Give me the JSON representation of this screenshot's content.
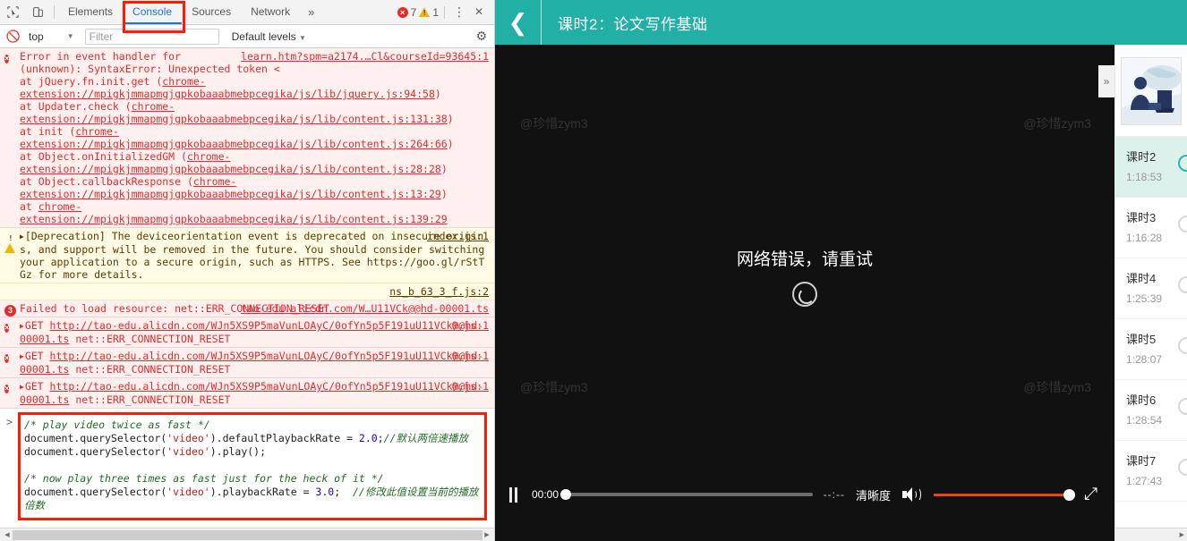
{
  "devtools": {
    "toolbar": {
      "inspect_icon": "cursor-inspect-icon",
      "device_icon": "device-toolbar-icon",
      "tabs": [
        {
          "label": "Elements",
          "active": false
        },
        {
          "label": "Console",
          "active": true
        },
        {
          "label": "Sources",
          "active": false
        },
        {
          "label": "Network",
          "active": false
        }
      ],
      "more_tabs": "»",
      "error_count": "7",
      "warning_count": "1",
      "kebab_icon": "more-options-icon",
      "close_icon": "close-icon"
    },
    "filterbar": {
      "clear_icon": "clear-console-icon",
      "context": "top",
      "filter_placeholder": "Filter",
      "filter_value": "",
      "levels": "Default levels",
      "settings_icon": "gear-icon"
    },
    "messages": [
      {
        "type": "error",
        "source": "learn.htm?spm=a2174.…Cl&courseId=93645:1",
        "line1": "Error in event handler for",
        "line2": "(unknown): SyntaxError: Unexpected token <",
        "stack": [
          {
            "fn": "at jQuery.fn.init.get",
            "url": "chrome-extension://mpigkjmmapmgjgpkobaaabmebpcegika/js/lib/jquery.js:94:58"
          },
          {
            "fn": "at Updater.check",
            "url": "chrome-extension://mpigkjmmapmgjgpkobaaabmebpcegika/js/lib/content.js:131:38"
          },
          {
            "fn": "at init",
            "url": "chrome-extension://mpigkjmmapmgjgpkobaaabmebpcegika/js/lib/content.js:264:66"
          },
          {
            "fn": "at Object.onInitializedGM",
            "url": "chrome-extension://mpigkjmmapmgjgpkobaaabmebpcegika/js/lib/content.js:28:28"
          },
          {
            "fn": "at Object.callbackResponse",
            "url": "chrome-extension://mpigkjmmapmgjgpkobaaabmebpcegika/js/lib/content.js:13:29"
          },
          {
            "fn": "at",
            "url": "chrome-extension://mpigkjmmapmgjgpkobaaabmebpcegika/js/lib/content.js:139:29"
          }
        ]
      },
      {
        "type": "warn",
        "source": "index.js:1",
        "text": "[Deprecation] The deviceorientation event is deprecated on insecure origins, and support will be removed in the future. You should consider switching your application to a secure origin, such as HTTPS. See https://goo.gl/rStTGz for more details.",
        "link": "https://goo.gl/rStTGz"
      },
      {
        "type": "source-only",
        "source": "ns_b_63_3_f.js:2"
      },
      {
        "type": "error-group",
        "badge": "3",
        "text": "Failed to load resource: net::ERR_CONNECTION_RESET",
        "source": "tao-edu.alicdn.com/W…U11VCk@@hd-00001.ts"
      },
      {
        "type": "error-get",
        "method": "GET",
        "url": "http://tao-edu.alicdn.com/WJn5XS9P5maVunLOAyC/0ofYn5p5F191uU11VCk@@hd-00001.ts",
        "status": "net::ERR_CONNECTION_RESET",
        "source": "0.js:1"
      },
      {
        "type": "error-get",
        "method": "GET",
        "url": "http://tao-edu.alicdn.com/WJn5XS9P5maVunLOAyC/0ofYn5p5F191uU11VCk@@hd-00001.ts",
        "status": "net::ERR_CONNECTION_RESET",
        "source": "0.js:1"
      },
      {
        "type": "error-get",
        "method": "GET",
        "url": "http://tao-edu.alicdn.com/WJn5XS9P5maVunLOAyC/0ofYn5p5F191uU11VCk@@hd-00001.ts",
        "status": "net::ERR_CONNECTION_RESET",
        "source": "0.js:1"
      }
    ],
    "prompt": {
      "arrow": ">",
      "code": {
        "comment1": "/* play video twice as fast */",
        "l2_pre": "document.querySelector(",
        "l2_str": "'video'",
        "l2_mid": ").defaultPlaybackRate = ",
        "l2_num": "2.0",
        "l2_end": ";",
        "l2_cn": "//默认两倍速播放",
        "l3_pre": "document.querySelector(",
        "l3_str": "'video'",
        "l3_end": ").play();",
        "comment2": "/* now play three times as fast just for the heck of it */",
        "l5_pre": "document.querySelector(",
        "l5_str": "'video'",
        "l5_mid": ").playbackRate = ",
        "l5_num": "3.0",
        "l5_end": ";",
        "l5_cn": "//修改此值设置当前的播放倍数"
      }
    },
    "scrollbar": {
      "left_arrow": "◀",
      "right_arrow": "▶"
    }
  },
  "site": {
    "header": {
      "back_icon": "back-chevron-icon",
      "title": "课时2：论文写作基础"
    },
    "player": {
      "watermark": "@珍惜zym3",
      "error_text": "网络错误，请重试",
      "retry_icon": "retry-circle-icon",
      "collapse_icon": "»",
      "controls": {
        "pause_icon": "pause-icon",
        "current_time": "00:00",
        "duration": "--:--",
        "quality_label": "清晰度",
        "volume_icon": "volume-icon",
        "fullscreen_icon": "fullscreen-icon",
        "progress_percent": 0,
        "volume_percent": 100
      }
    },
    "playlist": {
      "thumbnail_alt": "course-thumbnail",
      "items": [
        {
          "name": "课时2",
          "time": "1:18:53",
          "active": true
        },
        {
          "name": "课时3",
          "time": "1:16:28",
          "active": false
        },
        {
          "name": "课时4",
          "time": "1:25:39",
          "active": false
        },
        {
          "name": "课时5",
          "time": "1:28:07",
          "active": false
        },
        {
          "name": "课时6",
          "time": "1:28:54",
          "active": false
        },
        {
          "name": "课时7",
          "time": "1:27:43",
          "active": false
        }
      ],
      "scroll_arrow": "▶"
    }
  },
  "colors": {
    "brand_teal": "#22b0a6",
    "active_item_bg": "#dcf0ec",
    "error_red": "#e52b2b",
    "warn_yellow": "#fffbe5",
    "volume_orange": "#e8470f",
    "devtools_blue": "#1a73e8",
    "highlight_red": "#ff1a00"
  }
}
